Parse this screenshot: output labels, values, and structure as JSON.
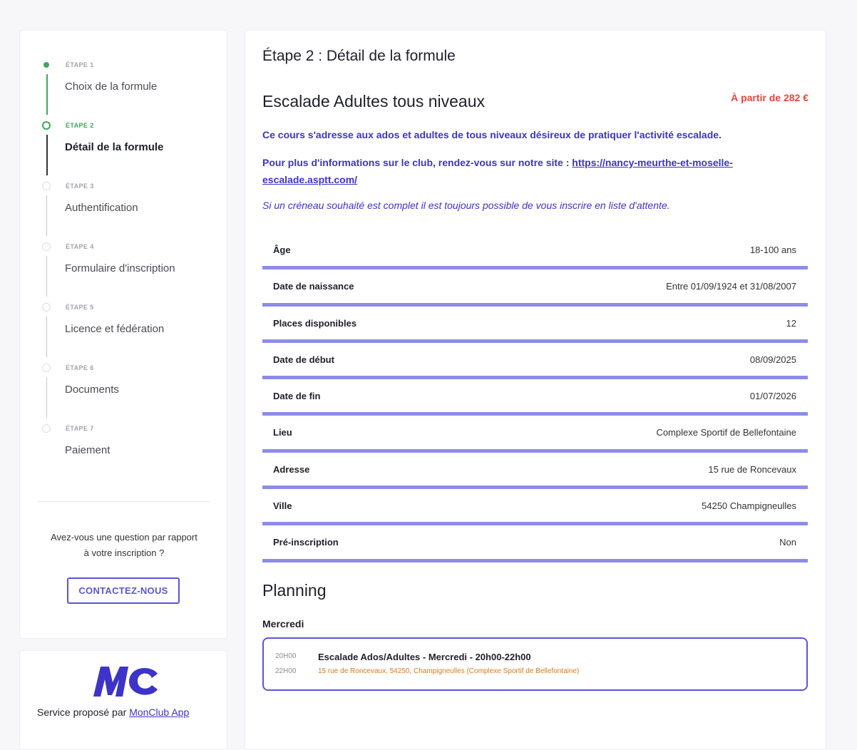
{
  "sidebar": {
    "steps": [
      {
        "num": "ÉTAPE 1",
        "label": "Choix de la formule",
        "state": "done"
      },
      {
        "num": "ÉTAPE 2",
        "label": "Détail de la formule",
        "state": "active"
      },
      {
        "num": "ÉTAPE 3",
        "label": "Authentification",
        "state": "pending"
      },
      {
        "num": "ÉTAPE 4",
        "label": "Formulaire d'inscription",
        "state": "pending"
      },
      {
        "num": "ÉTAPE 5",
        "label": "Licence et fédération",
        "state": "pending"
      },
      {
        "num": "ÉTAPE 6",
        "label": "Documents",
        "state": "pending"
      },
      {
        "num": "ÉTAPE 7",
        "label": "Paiement",
        "state": "pending"
      }
    ],
    "question": "Avez-vous une question par rapport à votre inscription ?",
    "contact_button": "CONTACTEZ-NOUS"
  },
  "promo": {
    "logo_text": "MC",
    "service_prefix": "Service proposé par ",
    "service_link": "MonClub App"
  },
  "main": {
    "page_title": "Étape 2 : Détail de la formule",
    "formula_title": "Escalade Adultes tous niveaux",
    "price": "À partir de 282 €",
    "description": "Ce cours s'adresse aux ados et adultes de tous niveaux désireux de pratiquer l'activité escalade.",
    "info_prefix": "Pour plus d'informations sur le club, rendez-vous sur notre site : ",
    "info_link": "https://nancy-meurthe-et-moselle-escalade.asptt.com/",
    "waitlist": "Si un créneau souhaité est complet il est toujours possible de vous inscrire en liste d'attente.",
    "details": [
      {
        "key": "Âge",
        "value": "18-100 ans"
      },
      {
        "key": "Date de naissance",
        "value": "Entre 01/09/1924 et 31/08/2007"
      },
      {
        "key": "Places disponibles",
        "value": "12"
      },
      {
        "key": "Date de début",
        "value": "08/09/2025"
      },
      {
        "key": "Date de fin",
        "value": "01/07/2026"
      },
      {
        "key": "Lieu",
        "value": "Complexe Sportif de Bellefontaine"
      },
      {
        "key": "Adresse",
        "value": "15 rue de Roncevaux"
      },
      {
        "key": "Ville",
        "value": "54250 Champigneulles"
      },
      {
        "key": "Pré-inscription",
        "value": "Non"
      }
    ],
    "planning_title": "Planning",
    "day": "Mercredi",
    "slot": {
      "start": "20H00",
      "end": "22H00",
      "title": "Escalade Ados/Adultes - Mercredi - 20h00-22h00",
      "address": "15 rue de Roncevaux, 54250, Champigneulles (Complexe Sportif de Bellefontaine)"
    }
  },
  "colors": {
    "accent": "#5a55d6",
    "link": "#3d33c9",
    "success": "#3fa85b",
    "price": "#e8453c",
    "row_border": "#8e8bea",
    "slot_address": "#d9781e"
  }
}
